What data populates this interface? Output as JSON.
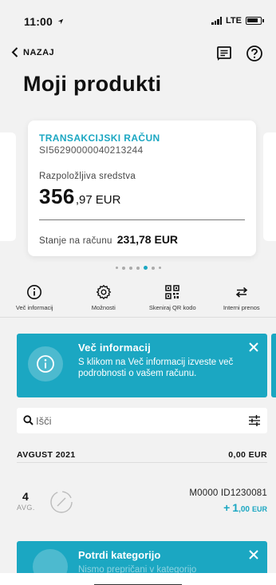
{
  "status_bar": {
    "time": "11:00",
    "carrier": "LTE"
  },
  "nav": {
    "back_label": "NAZAJ"
  },
  "page": {
    "title": "Moji produkti"
  },
  "account_card": {
    "type": "TRANSAKCIJSKI RAČUN",
    "iban": "SI56290000040213244",
    "available_label": "Razpoložljiva sredstva",
    "available_integer": "356",
    "available_decimal": ",97",
    "currency": "EUR",
    "balance_label": "Stanje na računu",
    "balance_value": "231,78 EUR"
  },
  "actions": [
    {
      "label": "Več informacij",
      "icon": "info-icon"
    },
    {
      "label": "Možnosti",
      "icon": "gear-icon"
    },
    {
      "label": "Skeniraj QR kodo",
      "icon": "qr-code-icon"
    },
    {
      "label": "Interni prenos",
      "icon": "transfer-arrows-icon"
    }
  ],
  "info_banner": {
    "title": "Več informacij",
    "text": "S klikom na Več informacij izveste več podrobnosti o vašem računu."
  },
  "search": {
    "placeholder": "Išči"
  },
  "month_group": {
    "month": "AVGUST 2021",
    "total": "0,00 EUR"
  },
  "transaction": {
    "day": "4",
    "month": "AVG.",
    "description": "M0000 ID1230081",
    "sign": "+",
    "amount_integer": "1",
    "amount_decimal": ",00",
    "currency": "EUR"
  },
  "category_banner": {
    "title": "Potrdi kategorijo",
    "text": "Nismo prepričani v kategorijo"
  },
  "colors": {
    "accent": "#1ba7c2",
    "background": "#f2f2f2"
  }
}
